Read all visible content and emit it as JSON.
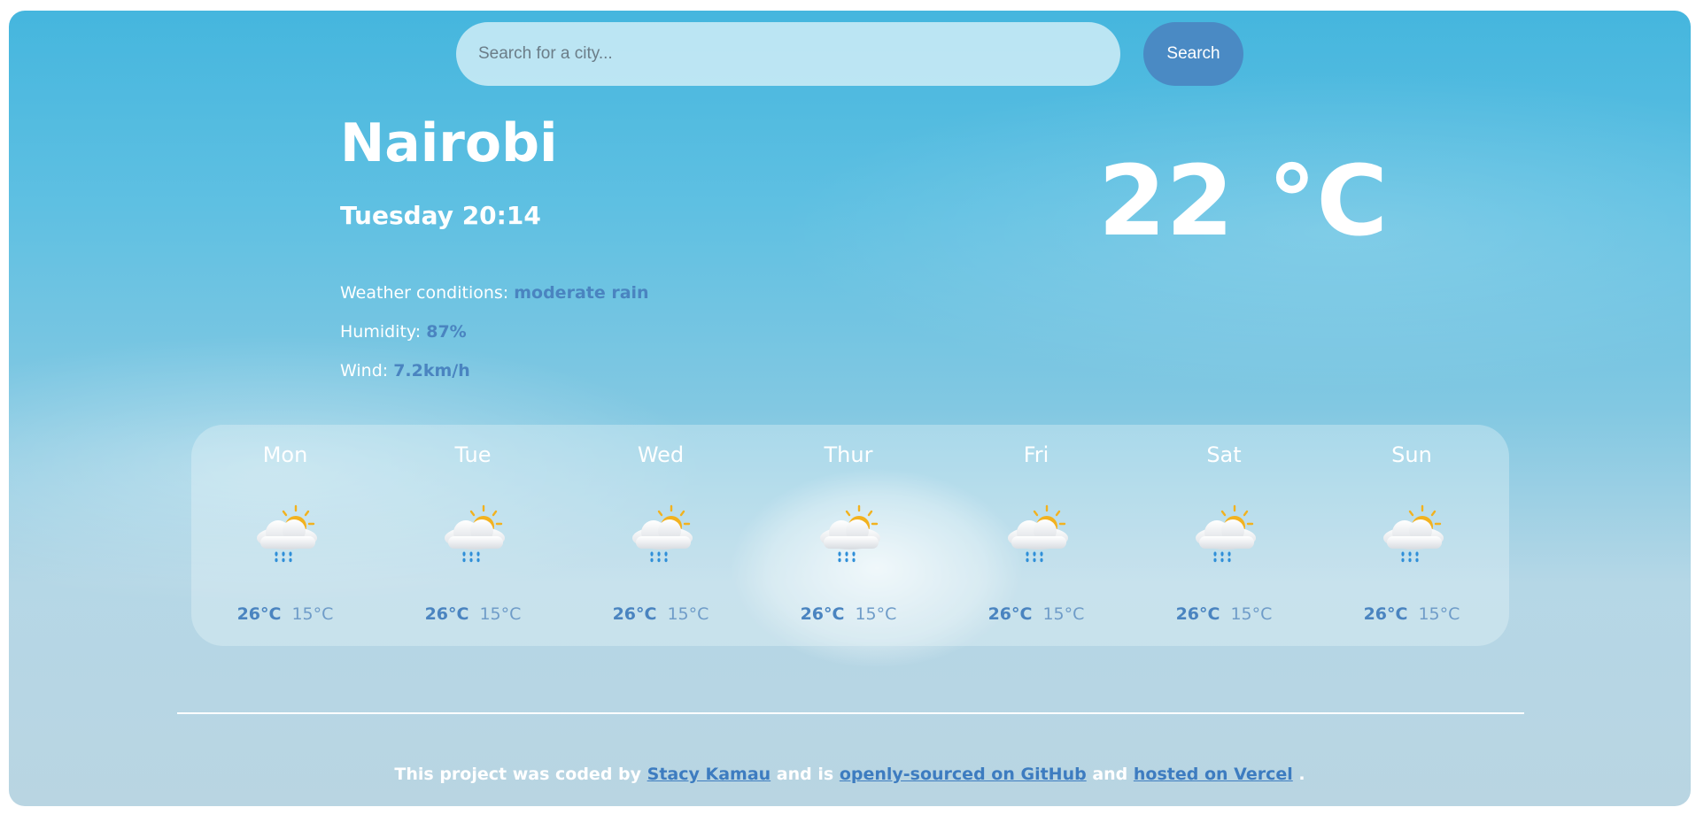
{
  "search": {
    "placeholder": "Search for a city...",
    "button_label": "Search"
  },
  "current": {
    "city": "Nairobi",
    "datetime": "Tuesday 20:14",
    "conditions_label": "Weather conditions: ",
    "conditions_value": "moderate rain",
    "humidity_label": "Humidity: ",
    "humidity_value": "87%",
    "wind_label": "Wind: ",
    "wind_value": "7.2km/h",
    "temperature": "22 °C"
  },
  "forecast": [
    {
      "day": "Mon",
      "max": "26°C",
      "min": "15°C",
      "icon": "sun-behind-rain-cloud-icon"
    },
    {
      "day": "Tue",
      "max": "26°C",
      "min": "15°C",
      "icon": "sun-behind-rain-cloud-icon"
    },
    {
      "day": "Wed",
      "max": "26°C",
      "min": "15°C",
      "icon": "sun-behind-rain-cloud-icon"
    },
    {
      "day": "Thur",
      "max": "26°C",
      "min": "15°C",
      "icon": "sun-behind-rain-cloud-icon"
    },
    {
      "day": "Fri",
      "max": "26°C",
      "min": "15°C",
      "icon": "sun-behind-rain-cloud-icon"
    },
    {
      "day": "Sat",
      "max": "26°C",
      "min": "15°C",
      "icon": "sun-behind-rain-cloud-icon"
    },
    {
      "day": "Sun",
      "max": "26°C",
      "min": "15°C",
      "icon": "sun-behind-rain-cloud-icon"
    }
  ],
  "footer": {
    "text1": "This project was coded by ",
    "author_link": "Stacy Kamau",
    "text2": " and is ",
    "github_link": "openly-sourced on GitHub",
    "text3": " and ",
    "vercel_link": "hosted on Vercel",
    "text4": " ."
  },
  "colors": {
    "accent": "#4a84c0",
    "button": "#4a8ac4",
    "text": "#ffffff"
  }
}
